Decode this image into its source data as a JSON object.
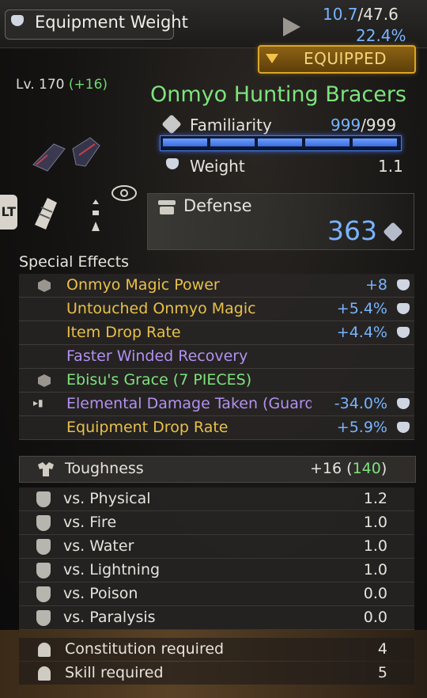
{
  "header": {
    "weight_label": "Equipment Weight",
    "weight_current": "10.7",
    "weight_sep": "/",
    "weight_max": "47.6",
    "weight_pct": "22.4%",
    "equipped_label": "EQUIPPED"
  },
  "item": {
    "level": "Lv. 170",
    "level_bonus": "(+16)",
    "name": "Onmyo Hunting Bracers",
    "familiarity_label": "Familiarity",
    "familiarity_value": "999",
    "familiarity_max": "/999",
    "familiarity_fraction": 1.0,
    "weight_label": "Weight",
    "weight_value": "1.1",
    "slot_badge": "LT"
  },
  "defense": {
    "label": "Defense",
    "value": "363"
  },
  "special_effects": {
    "title": "Special Effects",
    "rows": [
      {
        "name": "Onmyo Magic Power",
        "value": "+8",
        "color": "#e8c04a",
        "icon": "hex-icon"
      },
      {
        "name": "Untouched Onmyo Magic",
        "value": "+5.4%",
        "color": "#e8c04a",
        "icon": ""
      },
      {
        "name": "Item Drop Rate",
        "value": "+4.4%",
        "color": "#e8c04a",
        "icon": ""
      },
      {
        "name": "Faster Winded Recovery",
        "value": "",
        "color": "#b291f0",
        "icon": ""
      },
      {
        "name": "Ebisu's Grace (7 PIECES)",
        "value": "",
        "color": "#7de37d",
        "icon": "hex-icon"
      },
      {
        "name": "Elemental Damage Taken (Guardir",
        "value": "-34.0%",
        "color": "#b291f0",
        "icon": "arrow-icon"
      },
      {
        "name": "Equipment Drop Rate",
        "value": "+5.9%",
        "color": "#e8c04a",
        "icon": ""
      }
    ]
  },
  "toughness": {
    "label": "Toughness",
    "value": "+16",
    "total": "(140)",
    "total_inner": "140"
  },
  "resistances": [
    {
      "name": "vs. Physical",
      "value": "1.2"
    },
    {
      "name": "vs. Fire",
      "value": "1.0"
    },
    {
      "name": "vs. Water",
      "value": "1.0"
    },
    {
      "name": "vs. Lightning",
      "value": "1.0"
    },
    {
      "name": "vs. Poison",
      "value": "0.0"
    },
    {
      "name": "vs. Paralysis",
      "value": "0.0"
    }
  ],
  "requirements": [
    {
      "name": "Constitution required",
      "value": "4"
    },
    {
      "name": "Skill required",
      "value": "5"
    }
  ]
}
